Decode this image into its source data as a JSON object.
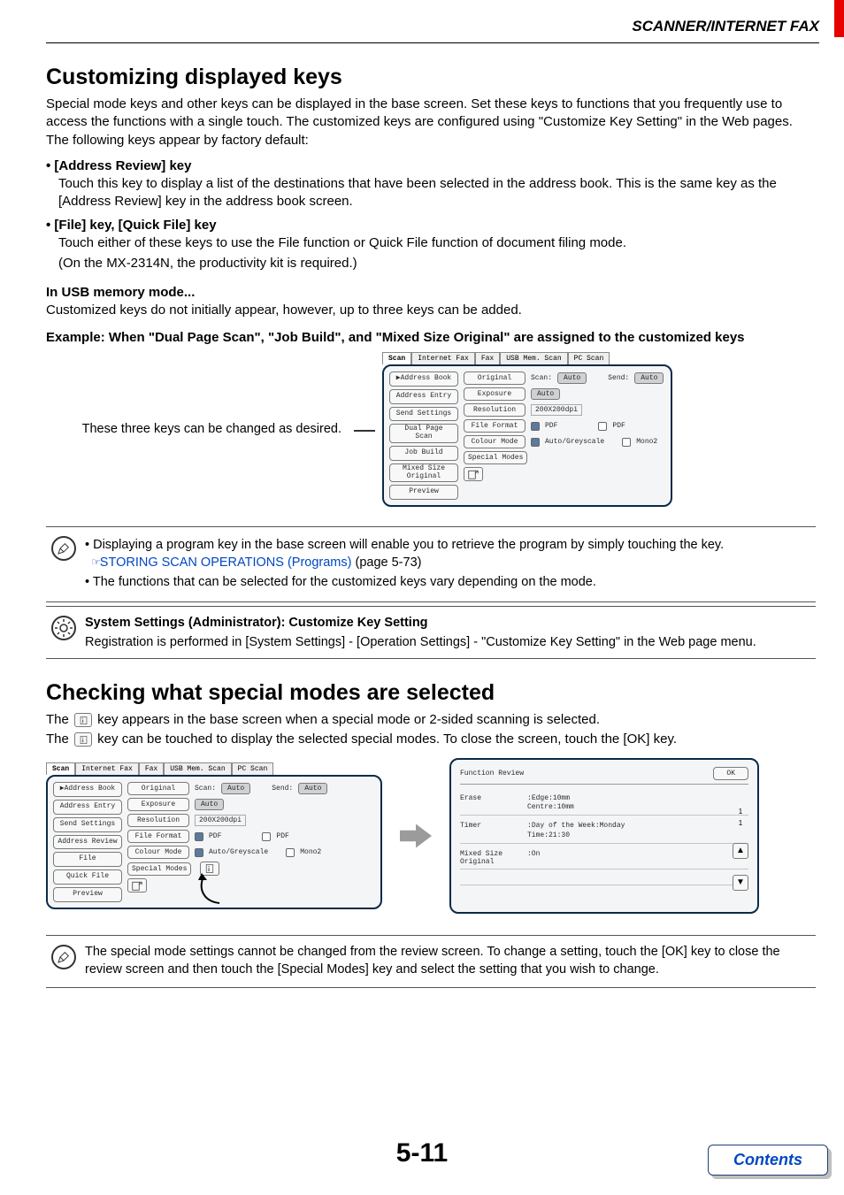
{
  "header": {
    "title": "SCANNER/INTERNET FAX"
  },
  "section1": {
    "heading": "Customizing displayed keys",
    "intro": "Special mode keys and other keys can be displayed in the base screen. Set these keys to functions that you frequently use to access the functions with a single touch. The customized keys are configured using \"Customize Key Setting\" in the Web pages. The following keys appear by factory default:",
    "bullet1_head": "• [Address Review] key",
    "bullet1_body": "Touch this key to display a list of the destinations that have been selected in the address book. This is the same key as the [Address Review] key in the address book screen.",
    "bullet2_head": "• [File] key, [Quick File] key",
    "bullet2_body1": "Touch either of these keys to use the File function or Quick File function of document filing mode.",
    "bullet2_body2": "(On the MX-2314N, the productivity kit is required.)",
    "usb_head": "In USB memory mode...",
    "usb_body": "Customized keys do not initially appear, however, up to three keys can be added.",
    "example_head": "Example: When \"Dual Page Scan\", \"Job Build\", and \"Mixed Size Original\" are assigned to the customized keys",
    "example_caption": "These three keys can be changed as desired."
  },
  "panel_example": {
    "tabs": [
      "Scan",
      "Internet Fax",
      "Fax",
      "USB Mem. Scan",
      "PC Scan"
    ],
    "left": [
      "Address Book",
      "Address Entry",
      "Send Settings",
      "Dual Page\nScan",
      "Job Build",
      "Mixed Size\nOriginal",
      "Preview"
    ],
    "rows": {
      "original": {
        "label": "Original",
        "scan_label": "Scan:",
        "scan_val": "Auto",
        "send_label": "Send:",
        "send_val": "Auto"
      },
      "exposure": {
        "label": "Exposure",
        "val": "Auto"
      },
      "resolution": {
        "label": "Resolution",
        "val": "200X200dpi"
      },
      "fileformat": {
        "label": "File Format",
        "val1": "PDF",
        "val2": "PDF"
      },
      "colourmode": {
        "label": "Colour Mode",
        "val1": "Auto/Greyscale",
        "val2": "Mono2"
      },
      "specialmodes": {
        "label": "Special Modes"
      }
    }
  },
  "note1": {
    "bullet1_pre": "Displaying a program key in the base screen will enable you to retrieve the program by simply touching the key.",
    "link_icon": "☞",
    "link_text": "STORING SCAN OPERATIONS (Programs)",
    "link_suffix": " (page 5-73)",
    "bullet2": "The functions that can be selected for the customized keys vary depending on the mode."
  },
  "admin_note": {
    "title": "System Settings (Administrator): Customize Key Setting",
    "body": "Registration is performed in [System Settings] - [Operation Settings] - \"Customize Key Setting\" in the Web page menu."
  },
  "section2": {
    "heading": "Checking what special modes are selected",
    "line1_pre": "The ",
    "line1_post": " key appears in the base screen when a special mode or 2-sided scanning is selected.",
    "line2_pre": "The ",
    "line2_post": " key can be touched to display the selected special modes. To close the screen, touch the [OK] key."
  },
  "panel_base": {
    "tabs": [
      "Scan",
      "Internet Fax",
      "Fax",
      "USB Mem. Scan",
      "PC Scan"
    ],
    "left": [
      "Address Book",
      "Address Entry",
      "Send Settings",
      "Address Review",
      "File",
      "Quick File",
      "Preview"
    ],
    "rows": {
      "original": {
        "label": "Original",
        "scan_label": "Scan:",
        "scan_val": "Auto",
        "send_label": "Send:",
        "send_val": "Auto"
      },
      "exposure": {
        "label": "Exposure",
        "val": "Auto"
      },
      "resolution": {
        "label": "Resolution",
        "val": "200X200dpi"
      },
      "fileformat": {
        "label": "File Format",
        "val1": "PDF",
        "val2": "PDF"
      },
      "colourmode": {
        "label": "Colour Mode",
        "val1": "Auto/Greyscale",
        "val2": "Mono2"
      },
      "specialmodes": {
        "label": "Special Modes"
      }
    }
  },
  "review_panel": {
    "title": "Function Review",
    "ok": "OK",
    "rows": [
      {
        "label": "Erase",
        "val": "Edge:10mm\nCentre:10mm"
      },
      {
        "label": "Timer",
        "val": "Day of the Week:Monday\nTime:21:30"
      },
      {
        "label": "Mixed Size\nOriginal",
        "val": ":On"
      }
    ],
    "page_indicator_top": "1",
    "page_indicator_bottom": "1",
    "up": "⬆",
    "down": "⬇"
  },
  "note2": {
    "body": "The special mode settings cannot be changed from the review screen. To change a setting, touch the [OK] key to close the review screen and then touch the [Special Modes] key and select the setting that you wish to change."
  },
  "footer": {
    "page_number": "5-11",
    "contents": "Contents"
  }
}
